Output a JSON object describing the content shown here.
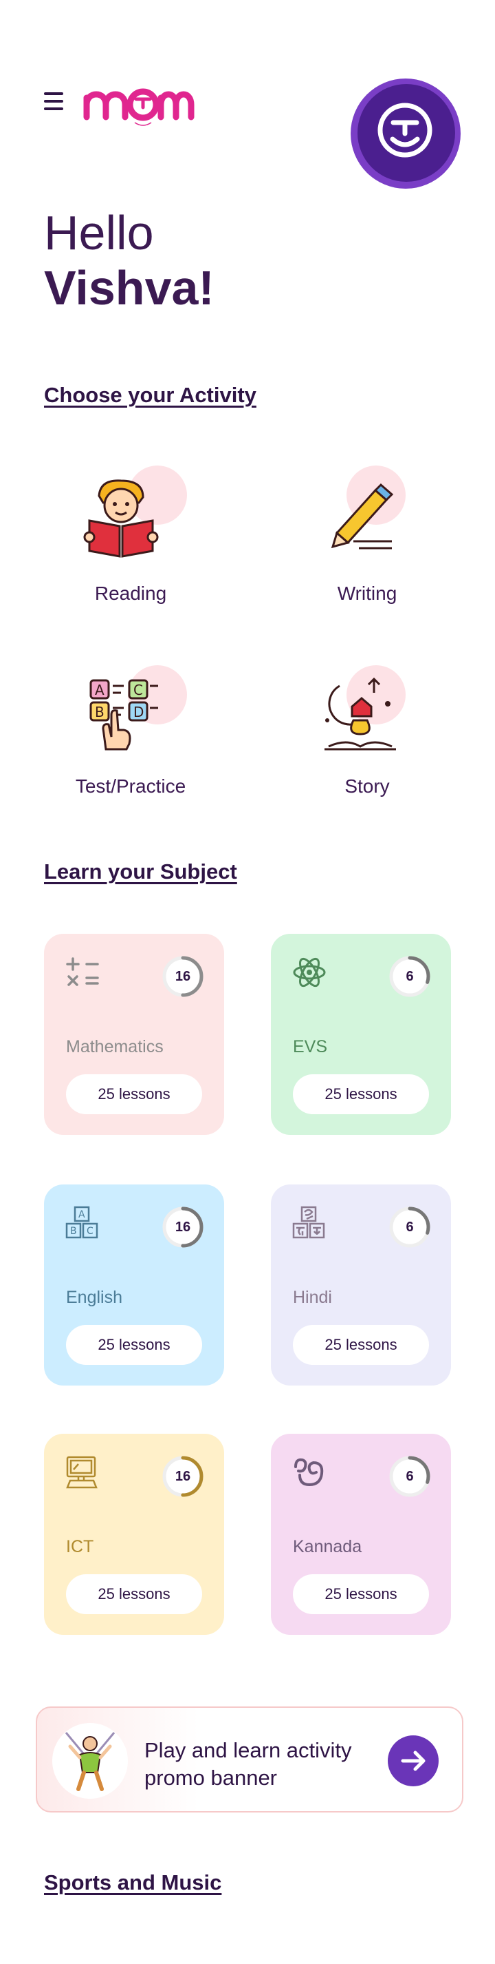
{
  "header": {
    "greeting_line1": "Hello",
    "greeting_line2": "Vishva!"
  },
  "activities": {
    "title": "Choose your Activity",
    "items": [
      {
        "label": "Reading",
        "icon": "reading-boy-icon"
      },
      {
        "label": "Writing",
        "icon": "pencil-icon"
      },
      {
        "label": "Test/Practice",
        "icon": "abcd-blocks-icon"
      },
      {
        "label": "Story",
        "icon": "story-book-icon"
      }
    ]
  },
  "subjects": {
    "title": "Learn your Subject",
    "items": [
      {
        "name": "Mathematics",
        "count": "16",
        "lessons": "25 lessons",
        "bg": "#fde6e6",
        "text_color": "#8c8c8c",
        "ring_color": "#8c8c8c",
        "progress": 0.5,
        "icon": "math-symbols-icon"
      },
      {
        "name": "EVS",
        "count": "6",
        "lessons": "25 lessons",
        "bg": "#d3f5dc",
        "text_color": "#4e8a5a",
        "ring_color": "#777777",
        "progress": 0.3,
        "icon": "atom-icon"
      },
      {
        "name": "English",
        "count": "16",
        "lessons": "25 lessons",
        "bg": "#ccedff",
        "text_color": "#4b7c97",
        "ring_color": "#777777",
        "progress": 0.5,
        "icon": "abc-blocks-icon"
      },
      {
        "name": "Hindi",
        "count": "6",
        "lessons": "25 lessons",
        "bg": "#ebebfa",
        "text_color": "#8a7a8f",
        "ring_color": "#777777",
        "progress": 0.3,
        "icon": "hindi-letters-icon"
      },
      {
        "name": "ICT",
        "count": "16",
        "lessons": "25 lessons",
        "bg": "#fff0c9",
        "text_color": "#b08a2e",
        "ring_color": "#b08a2e",
        "progress": 0.5,
        "icon": "computer-icon"
      },
      {
        "name": "Kannada",
        "count": "6",
        "lessons": "25 lessons",
        "bg": "#f6daf2",
        "text_color": "#6e5a7a",
        "ring_color": "#777777",
        "progress": 0.3,
        "icon": "kannada-letter-icon"
      }
    ]
  },
  "promo": {
    "text": "Play and learn activity promo banner",
    "icon": "gymnast-icon"
  },
  "sports": {
    "title": "Sports and Music"
  },
  "colors": {
    "primary": "#3b1a52",
    "accent_purple": "#6a35b8",
    "logo_pink": "#e0268f"
  }
}
